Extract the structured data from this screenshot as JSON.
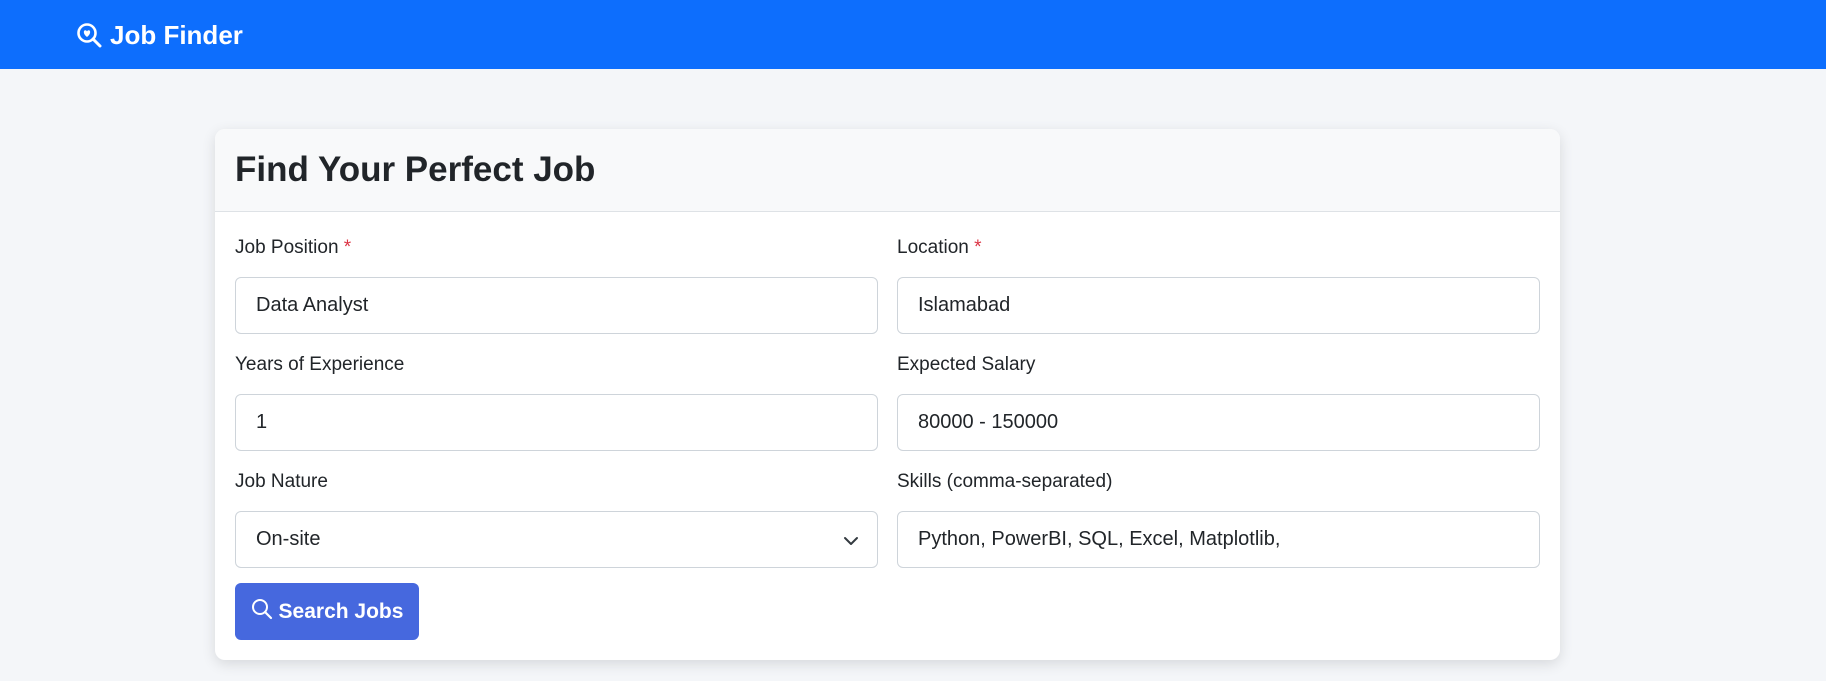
{
  "navbar": {
    "brand_icon": "search-heart-icon",
    "brand_text": "Job Finder",
    "color": "#0d6efd"
  },
  "card": {
    "title": "Find Your Perfect Job"
  },
  "form": {
    "job_position": {
      "label": "Job Position",
      "required_mark": "*",
      "value": "Data Analyst"
    },
    "location": {
      "label": "Location",
      "required_mark": "*",
      "value": "Islamabad"
    },
    "experience": {
      "label": "Years of Experience",
      "value": "1"
    },
    "salary": {
      "label": "Expected Salary",
      "value": "80000 - 150000"
    },
    "job_nature": {
      "label": "Job Nature",
      "selected": "On-site",
      "icon": "chevron-down-icon"
    },
    "skills": {
      "label": "Skills (comma-separated)",
      "value": "Python, PowerBI, SQL, Excel, Matplotlib,"
    }
  },
  "search_button": {
    "label": "Search Jobs",
    "icon": "search-icon",
    "color": "#4668de"
  }
}
